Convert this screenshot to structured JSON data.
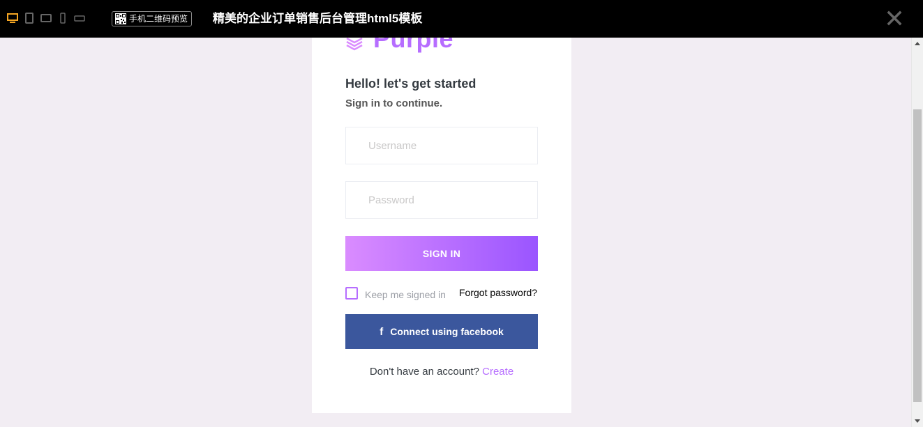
{
  "topbar": {
    "qr_label": "手机二维码预览",
    "title": "精美的企业订单销售后台管理html5模板"
  },
  "brand": {
    "name": "Purple"
  },
  "login": {
    "heading": "Hello! let's get started",
    "subheading": "Sign in to continue.",
    "username_placeholder": "Username",
    "password_placeholder": "Password",
    "signin_label": "SIGN IN",
    "keep_signed_in": "Keep me signed in",
    "forgot_password": "Forgot password?",
    "facebook_label": "Connect using facebook",
    "signup_prompt": "Don't have an account?",
    "create_label": "Create"
  },
  "colors": {
    "accent": "#b66dff",
    "facebook": "#3b579d",
    "background": "#f2edf3",
    "device_active": "#f5a623"
  },
  "icons": [
    "desktop-icon",
    "tablet-portrait-icon",
    "tablet-landscape-icon",
    "phone-portrait-icon",
    "phone-landscape-icon",
    "qr-code-icon",
    "close-icon",
    "layers-icon",
    "facebook-icon"
  ]
}
